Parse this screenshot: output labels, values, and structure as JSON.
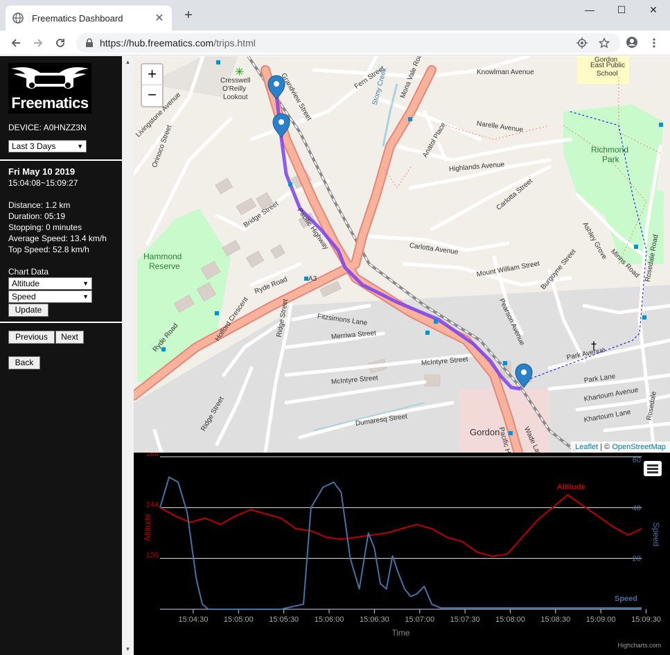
{
  "browser": {
    "tab_title": "Freematics Dashboard",
    "url_host": "https://hub.freematics.com",
    "url_path": "/trips.html"
  },
  "sidebar": {
    "logo_text": "Freematics",
    "device_label": "DEVICE: A0HNZZ3N",
    "range_select": "Last 3 Days",
    "trip_date": "Fri May 10 2019",
    "trip_time": "15:04:08~15:09:27",
    "distance": "Distance: 1.2 km",
    "duration": "Duration: 05:19",
    "stopping": "Stopping: 0 minutes",
    "avg_speed": "Average Speed: 13.4 km/h",
    "top_speed": "Top Speed: 52.8 km/h",
    "chart_data_label": "Chart Data",
    "select_1": "Altitude",
    "select_2": "Speed",
    "update_btn": "Update",
    "previous_btn": "Previous",
    "next_btn": "Next",
    "back_btn": "Back"
  },
  "map": {
    "zoom_in": "+",
    "zoom_out": "−",
    "attribution_leaflet": "Leaflet",
    "attribution_sep": " | © ",
    "attribution_osm": "OpenStreetMap",
    "labels": [
      {
        "text": "Cresswell",
        "name": "poi-cresswell"
      },
      {
        "text": "O'Reilly",
        "name": "poi-oreilly"
      },
      {
        "text": "Lookout",
        "name": "poi-lookout"
      },
      {
        "text": "Knowlman Avenue",
        "name": "street-knowlman"
      },
      {
        "text": "Fern Street",
        "name": "street-fern"
      },
      {
        "text": "Narelle Avenue",
        "name": "street-narelle"
      },
      {
        "text": "Highlands Avenue",
        "name": "street-highlands"
      },
      {
        "text": "Anatol Place",
        "name": "street-anatol"
      },
      {
        "text": "Carlotta Avenue",
        "name": "street-carlotta-1"
      },
      {
        "text": "Carlotta Street",
        "name": "street-carlotta-2"
      },
      {
        "text": "Mona Vale Road",
        "name": "street-mona-vale"
      },
      {
        "text": "Stony Creek",
        "name": "creek-stony"
      },
      {
        "text": "Richmond",
        "name": "park-richmond-1"
      },
      {
        "text": "Park",
        "name": "park-richmond-2"
      },
      {
        "text": "Gordon",
        "name": "school-gordon-1"
      },
      {
        "text": "East Public",
        "name": "school-gordon-2"
      },
      {
        "text": "School",
        "name": "school-gordon-3"
      },
      {
        "text": "Hammond",
        "name": "reserve-hammond-1"
      },
      {
        "text": "Reserve",
        "name": "reserve-hammond-2"
      },
      {
        "text": "Bridge Street",
        "name": "street-bridge"
      },
      {
        "text": "Pacific Highway",
        "name": "street-pacific-1"
      },
      {
        "text": "Ryde Road",
        "name": "street-ryde-1"
      },
      {
        "text": "Ryde Road",
        "name": "street-ryde-2"
      },
      {
        "text": "A3",
        "name": "route-a3"
      },
      {
        "text": "Fitzsimons Lane",
        "name": "street-fitzsimons"
      },
      {
        "text": "Merriwa Street",
        "name": "street-merriwa"
      },
      {
        "text": "McIntyre Street",
        "name": "street-mcintyre-1"
      },
      {
        "text": "McIntyre Street",
        "name": "street-mcintyre-2"
      },
      {
        "text": "Dumaresq Street",
        "name": "street-dumaresq"
      },
      {
        "text": "Gordon",
        "name": "suburb-gordon"
      },
      {
        "text": "Mount William Street",
        "name": "street-mount-william"
      },
      {
        "text": "Pearson Avenue",
        "name": "street-pearson"
      },
      {
        "text": "Burgoyne Street",
        "name": "street-burgoyne"
      },
      {
        "text": "Park Avenue",
        "name": "street-park-ave"
      },
      {
        "text": "Park Lane",
        "name": "street-park-lane"
      },
      {
        "text": "Khartoum Avenue",
        "name": "street-khartoum-ave"
      },
      {
        "text": "Khartoum Lane",
        "name": "street-khartoum-lane"
      },
      {
        "text": "Rosedale Road",
        "name": "street-rosedale"
      },
      {
        "text": "Minns Road",
        "name": "street-minns"
      },
      {
        "text": "Ashley Grove",
        "name": "street-ashley"
      },
      {
        "text": "Holford Crescent",
        "name": "street-holford"
      },
      {
        "text": "Ridge Street",
        "name": "street-ridge-1"
      },
      {
        "text": "Ridge Street",
        "name": "street-ridge-2"
      },
      {
        "text": "Grandview Street",
        "name": "street-grandview"
      },
      {
        "text": "Livingstone Avenue",
        "name": "street-livingstone"
      },
      {
        "text": "Orinoco Street",
        "name": "street-orinoco"
      },
      {
        "text": "Wade Lane",
        "name": "street-wade"
      },
      {
        "text": "Pacific High",
        "name": "street-pacific-2"
      },
      {
        "text": "Rosedale",
        "name": "street-rosedale-2"
      }
    ]
  },
  "chart_data": {
    "type": "line",
    "xlabel": "Time",
    "x_ticks": [
      "15:04:30",
      "15:05:00",
      "15:05:30",
      "15:06:00",
      "15:06:30",
      "15:07:00",
      "15:07:30",
      "15:08:00",
      "15:08:30",
      "15:09:00",
      "15:09:30"
    ],
    "y_left": {
      "label": "Altitude",
      "ticks": [
        "120",
        "144",
        "168"
      ],
      "range": [
        120,
        168
      ]
    },
    "y_right": {
      "label": "Speed",
      "ticks": [
        "20",
        "40",
        "60"
      ],
      "range": [
        0,
        60
      ]
    },
    "credit": "Highcharts.com",
    "series": [
      {
        "name": "Altitude",
        "color": "#c00000",
        "x": [
          0,
          10,
          20,
          30,
          40,
          50,
          60,
          70,
          80,
          90,
          100,
          110,
          120,
          130,
          140,
          150,
          160,
          170,
          180,
          190,
          200,
          210,
          220,
          230,
          240,
          250,
          260,
          270,
          280,
          290,
          300,
          310,
          319
        ],
        "values": [
          144,
          140,
          137,
          139,
          136,
          140,
          143,
          141,
          139,
          134,
          133,
          130,
          129,
          130,
          131,
          132,
          134,
          136,
          134,
          130,
          128,
          123,
          121,
          122,
          130,
          138,
          144,
          150,
          145,
          140,
          135,
          131,
          134
        ]
      },
      {
        "name": "Speed",
        "color": "#4572a7",
        "x": [
          0,
          6,
          12,
          18,
          24,
          28,
          32,
          40,
          60,
          80,
          95,
          100,
          108,
          115,
          120,
          126,
          132,
          138,
          142,
          146,
          150,
          154,
          158,
          162,
          166,
          170,
          175,
          180,
          186,
          192,
          198,
          210,
          240,
          270,
          300,
          319
        ],
        "values": [
          40,
          52,
          50,
          38,
          12,
          2,
          0,
          0,
          0,
          0,
          2,
          40,
          48,
          50,
          46,
          20,
          8,
          30,
          24,
          10,
          8,
          21,
          14,
          8,
          5,
          6,
          9,
          2,
          0.5,
          0.5,
          0.5,
          0.5,
          0.5,
          0.5,
          0.5,
          0.5
        ]
      }
    ]
  }
}
